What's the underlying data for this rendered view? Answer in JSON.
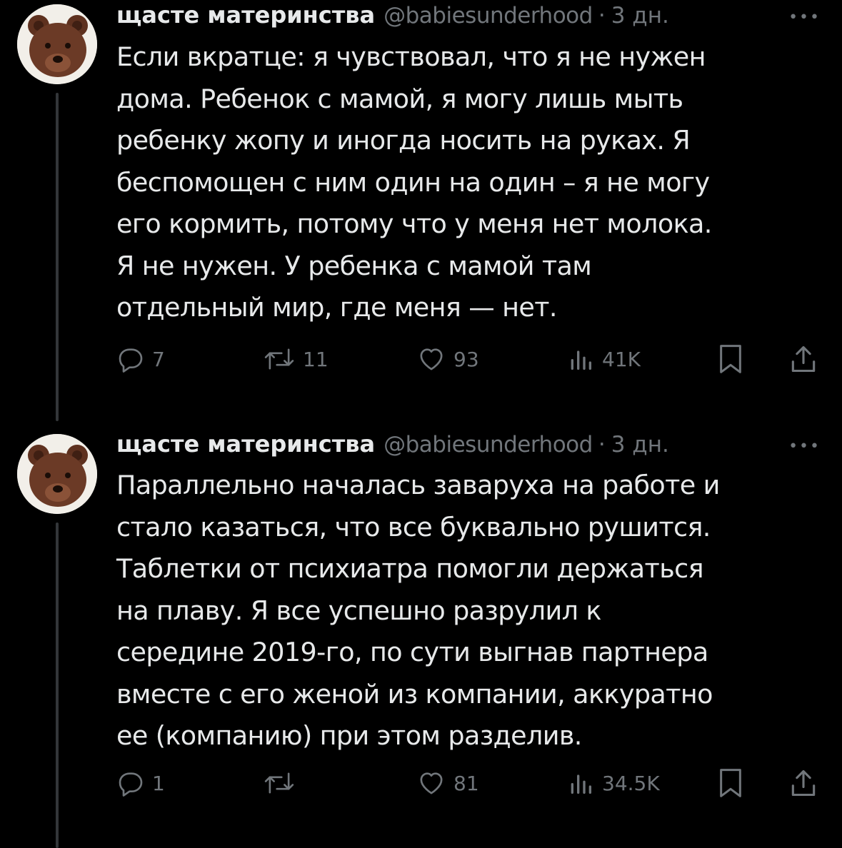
{
  "tweets": [
    {
      "author": "щасте материнства",
      "handle": "@babiesunderhood",
      "separator": "·",
      "time": "3 дн.",
      "more": "•••",
      "text": "Если вкратце: я чувствовал, что я не нужен\nдома. Ребенок с мамой, я могу лишь мыть\nребенку жопу и иногда носить на руках. Я\nбеспомощен с ним один на один – я не могу\nего кормить, потому что у меня нет молока.\nЯ не нужен. У ребенка с мамой там\nотдельный мир, где меня — нет.",
      "replies": "7",
      "retweets": "11",
      "likes": "93",
      "views": "41K"
    },
    {
      "author": "щасте материнства",
      "handle": "@babiesunderhood",
      "separator": "·",
      "time": "3 дн.",
      "more": "•••",
      "text": "Параллельно началась заваруха на работе и\nстало казаться, что все буквально рушится.\nТаблетки от психиатра помогли держаться\nна плаву. Я все успешно разрулил к\nсередине 2019-го, по сути выгнав партнера\nвместе с его женой из компании, аккуратно\nее (компанию) при этом разделив.",
      "replies": "1",
      "retweets": "",
      "likes": "81",
      "views": "34.5K"
    }
  ],
  "icons": {
    "avatar": "bear-avatar",
    "reply": "reply-icon",
    "retweet": "retweet-icon",
    "like": "heart-icon",
    "views": "views-icon",
    "bookmark": "bookmark-icon",
    "share": "share-icon"
  },
  "colors": {
    "background": "#000000",
    "text": "#e7e9ea",
    "secondary": "#71767b",
    "thread_line": "#333639",
    "avatar_bg": "#f2efe9",
    "bear": "#6b3a26"
  }
}
